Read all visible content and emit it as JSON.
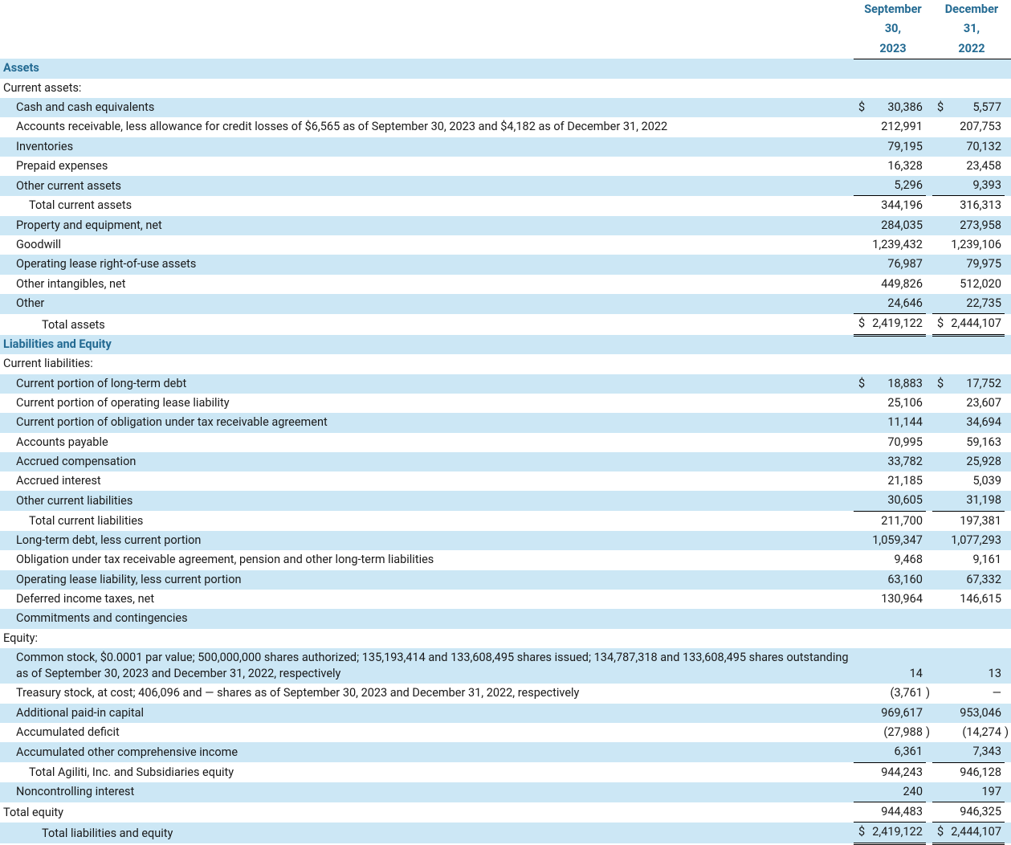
{
  "headers": {
    "col1_l1": "September",
    "col1_l2": "30,",
    "col1_l3": "2023",
    "col2_l1": "December",
    "col2_l2": "31,",
    "col2_l3": "2022"
  },
  "sections": {
    "assets": "Assets",
    "liab_eq": "Liabilities and Equity",
    "cur_assets": "Current assets:",
    "cur_liab": "Current liabilities:",
    "equity": "Equity:"
  },
  "rows": {
    "cash": {
      "label": "Cash and cash equivalents",
      "c1s": "$",
      "c1": "30,386",
      "c2s": "$",
      "c2": "5,577"
    },
    "ar": {
      "label": "Accounts receivable, less allowance for credit losses of $6,565 as of September 30, 2023 and $4,182 as of December 31, 2022",
      "c1": "212,991",
      "c2": "207,753"
    },
    "inv": {
      "label": "Inventories",
      "c1": "79,195",
      "c2": "70,132"
    },
    "prepaid": {
      "label": "Prepaid expenses",
      "c1": "16,328",
      "c2": "23,458"
    },
    "oca": {
      "label": "Other current assets",
      "c1": "5,296",
      "c2": "9,393"
    },
    "tca": {
      "label": "Total current assets",
      "c1": "344,196",
      "c2": "316,313"
    },
    "ppe": {
      "label": "Property and equipment, net",
      "c1": "284,035",
      "c2": "273,958"
    },
    "gw": {
      "label": "Goodwill",
      "c1": "1,239,432",
      "c2": "1,239,106"
    },
    "rou": {
      "label": "Operating lease right-of-use assets",
      "c1": "76,987",
      "c2": "79,975"
    },
    "intang": {
      "label": "Other intangibles, net",
      "c1": "449,826",
      "c2": "512,020"
    },
    "othera": {
      "label": "Other",
      "c1": "24,646",
      "c2": "22,735"
    },
    "ta": {
      "label": "Total assets",
      "c1s": "$",
      "c1": "2,419,122",
      "c2s": "$",
      "c2": "2,444,107"
    },
    "cpltd": {
      "label": "Current portion of long-term debt",
      "c1s": "$",
      "c1": "18,883",
      "c2s": "$",
      "c2": "17,752"
    },
    "cplease": {
      "label": "Current portion of operating lease liability",
      "c1": "25,106",
      "c2": "23,607"
    },
    "cptra": {
      "label": "Current portion of obligation under tax receivable agreement",
      "c1": "11,144",
      "c2": "34,694"
    },
    "ap": {
      "label": "Accounts payable",
      "c1": "70,995",
      "c2": "59,163"
    },
    "accomp": {
      "label": "Accrued compensation",
      "c1": "33,782",
      "c2": "25,928"
    },
    "accint": {
      "label": "Accrued interest",
      "c1": "21,185",
      "c2": "5,039"
    },
    "ocl": {
      "label": "Other current liabilities",
      "c1": "30,605",
      "c2": "31,198"
    },
    "tcl": {
      "label": "Total current liabilities",
      "c1": "211,700",
      "c2": "197,381"
    },
    "ltd": {
      "label": "Long-term debt, less current portion",
      "c1": "1,059,347",
      "c2": "1,077,293"
    },
    "tra": {
      "label": "Obligation under tax receivable agreement, pension and other long-term liabilities",
      "c1": "9,468",
      "c2": "9,161"
    },
    "ltlease": {
      "label": "Operating lease liability, less current portion",
      "c1": "63,160",
      "c2": "67,332"
    },
    "dit": {
      "label": "Deferred income taxes, net",
      "c1": "130,964",
      "c2": "146,615"
    },
    "commit": {
      "label": "Commitments and contingencies",
      "c1": "",
      "c2": ""
    },
    "cs": {
      "label": "Common stock, $0.0001 par value; 500,000,000 shares authorized; 135,193,414 and 133,608,495 shares issued; 134,787,318 and 133,608,495 shares outstanding as of September 30, 2023 and December 31, 2022, respectively",
      "c1": "14",
      "c2": "13"
    },
    "ts": {
      "label": "Treasury stock, at cost; 406,096 and — shares as of September 30, 2023 and December 31, 2022, respectively",
      "c1": "(3,761",
      "c1p": ")",
      "c2": "—"
    },
    "apic": {
      "label": "Additional paid-in capital",
      "c1": "969,617",
      "c2": "953,046"
    },
    "ad": {
      "label": "Accumulated deficit",
      "c1": "(27,988",
      "c1p": ")",
      "c2": "(14,274",
      "c2p": ")"
    },
    "aoci": {
      "label": "Accumulated other comprehensive income",
      "c1": "6,361",
      "c2": "7,343"
    },
    "teqsub": {
      "label": "Total Agiliti, Inc. and Subsidiaries equity",
      "c1": "944,243",
      "c2": "946,128"
    },
    "nci": {
      "label": "Noncontrolling interest",
      "c1": "240",
      "c2": "197"
    },
    "teq": {
      "label": "Total equity",
      "c1": "944,483",
      "c2": "946,325"
    },
    "tle": {
      "label": "Total liabilities and equity",
      "c1s": "$",
      "c1": "2,419,122",
      "c2s": "$",
      "c2": "2,444,107"
    }
  }
}
